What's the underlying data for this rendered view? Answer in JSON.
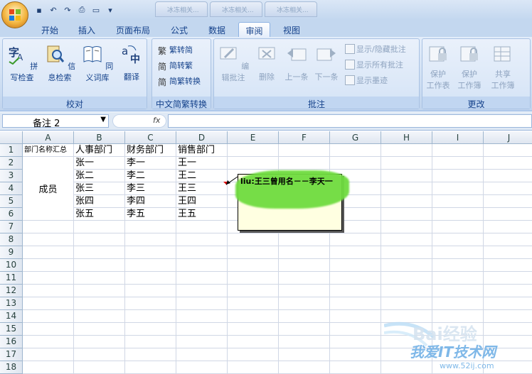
{
  "qat_icons": [
    "save-icon",
    "undo-icon",
    "redo-icon",
    "print-preview-icon",
    "layout-icon",
    "customize-icon"
  ],
  "title_tabs": [
    "冰冻相关...",
    "冰冻相关...",
    "冰冻相关..."
  ],
  "tabs": [
    {
      "label": "开始"
    },
    {
      "label": "插入"
    },
    {
      "label": "页面布局"
    },
    {
      "label": "公式"
    },
    {
      "label": "数据"
    },
    {
      "label": "审阅",
      "active": true
    },
    {
      "label": "视图"
    }
  ],
  "groups": {
    "proofing": {
      "title": "校对",
      "buttons": [
        "拼写检查",
        "信息检索",
        "同义词库",
        "翻译"
      ]
    },
    "chinese": {
      "title": "中文简繁转换",
      "buttons": [
        "繁转简",
        "简转繁",
        "简繁转换"
      ]
    },
    "comments": {
      "title": "批注",
      "buttons": [
        "编辑批注",
        "删除",
        "上一条",
        "下一条"
      ],
      "small": [
        "显示/隐藏批注",
        "显示所有批注",
        "显示墨迹"
      ]
    },
    "changes": {
      "title": "更改",
      "buttons": [
        [
          "保护",
          "工作表"
        ],
        [
          "保护",
          "工作簿"
        ],
        [
          "共享",
          "工作簿"
        ]
      ]
    }
  },
  "namebox": "备注 2",
  "fx": "fx",
  "columns": [
    "A",
    "B",
    "C",
    "D",
    "E",
    "F",
    "G",
    "H",
    "I",
    "J"
  ],
  "rows": [
    "1",
    "2",
    "3",
    "4",
    "5",
    "6",
    "7",
    "8",
    "9",
    "10",
    "11",
    "12",
    "13",
    "14",
    "15",
    "16",
    "17",
    "18"
  ],
  "cells": {
    "A1": "部门名称汇总",
    "B1": "人事部门",
    "C1": "财务部门",
    "D1": "销售部门",
    "B2": "张一",
    "C2": "李一",
    "D2": "王一",
    "B3": "张二",
    "C3": "李二",
    "D3": "王二",
    "B4": "张三",
    "C4": "李三",
    "D4": "王三",
    "B5": "张四",
    "C5": "李四",
    "D5": "王四",
    "B6": "张五",
    "C6": "李五",
    "D6": "王五",
    "A2_6": "成员"
  },
  "comment": {
    "text": "liu:王三曾用名－－李天一"
  },
  "watermark": {
    "brand": "Bai经验",
    "site_cn": "我爱IT技术网",
    "url": "www.52ij.com"
  },
  "colors": {
    "ribbon_text": "#15428b",
    "comment_bg": "#ffffe1",
    "highlight": "#6fdc3f"
  }
}
